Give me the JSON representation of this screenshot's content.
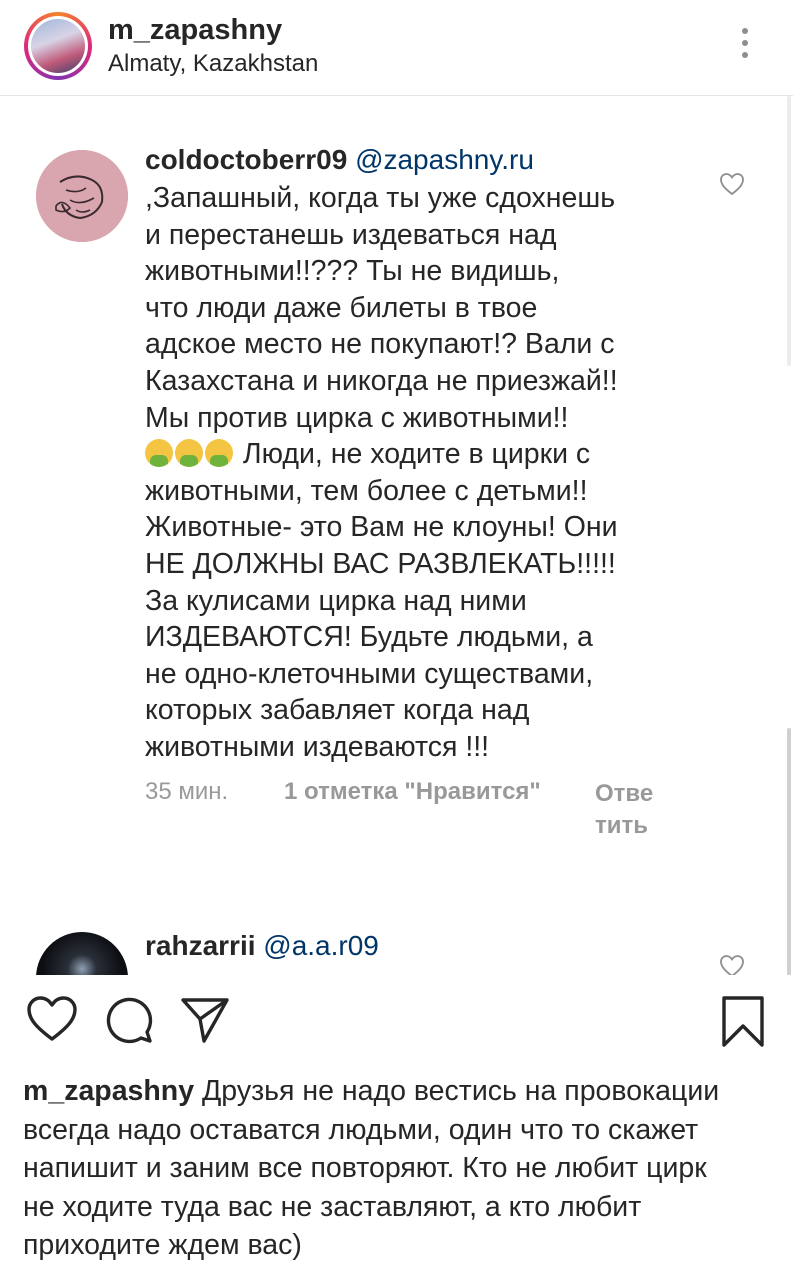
{
  "header": {
    "username": "m_zapashny",
    "location": "Almaty, Kazakhstan"
  },
  "comment": {
    "username": "coldoctoberr09",
    "mention": "@zapashny.ru",
    "lines": [
      ",Запашный, когда ты уже сдохнешь",
      "и перестанешь издеваться над",
      "животными!!??? Ты не видишь,",
      "что люди даже билеты в твое",
      "адское место не покупают!? Вали с",
      "Казахстана и никогда не приезжай!!",
      "Мы против цирка с животными!!",
      " Люди, не ходите в цирки с",
      "животными, тем более с детьми!!",
      "Животные- это Вам не клоуны! Они",
      "НЕ ДОЛЖНЫ ВАС РАЗВЛЕКАТЬ!!!!!",
      "За кулисами цирка над ними",
      "ИЗДЕВАЮТСЯ! Будьте людьми, а",
      "не одно-клеточными существами,",
      "которых забавляет когда над",
      "животными издеваются !!!"
    ],
    "emoji": "nauseated-face-emoji",
    "time": "35 мин.",
    "likes": "1 отметка \"Нравится\"",
    "reply": "Ответить"
  },
  "reply_comment": {
    "username": "rahzarrii",
    "mention": "@a.a.r09"
  },
  "caption": {
    "username": "m_zapashny",
    "first_line": " Друзья не надо вестись на провокации",
    "lines": [
      "всегда надо оставатся людьми, один что то скажет",
      "напишит и заним все повторяют. Кто не любит цирк",
      "не ходите туда вас не заставляют, а кто любит",
      "приходите ждем вас)"
    ]
  },
  "icons": {
    "like": "heart-icon",
    "comment": "comment-icon",
    "share": "send-icon",
    "save": "bookmark-icon",
    "more": "more-vertical-icon"
  },
  "colors": {
    "text": "#262626",
    "secondary": "#999999",
    "mention": "#003569"
  }
}
